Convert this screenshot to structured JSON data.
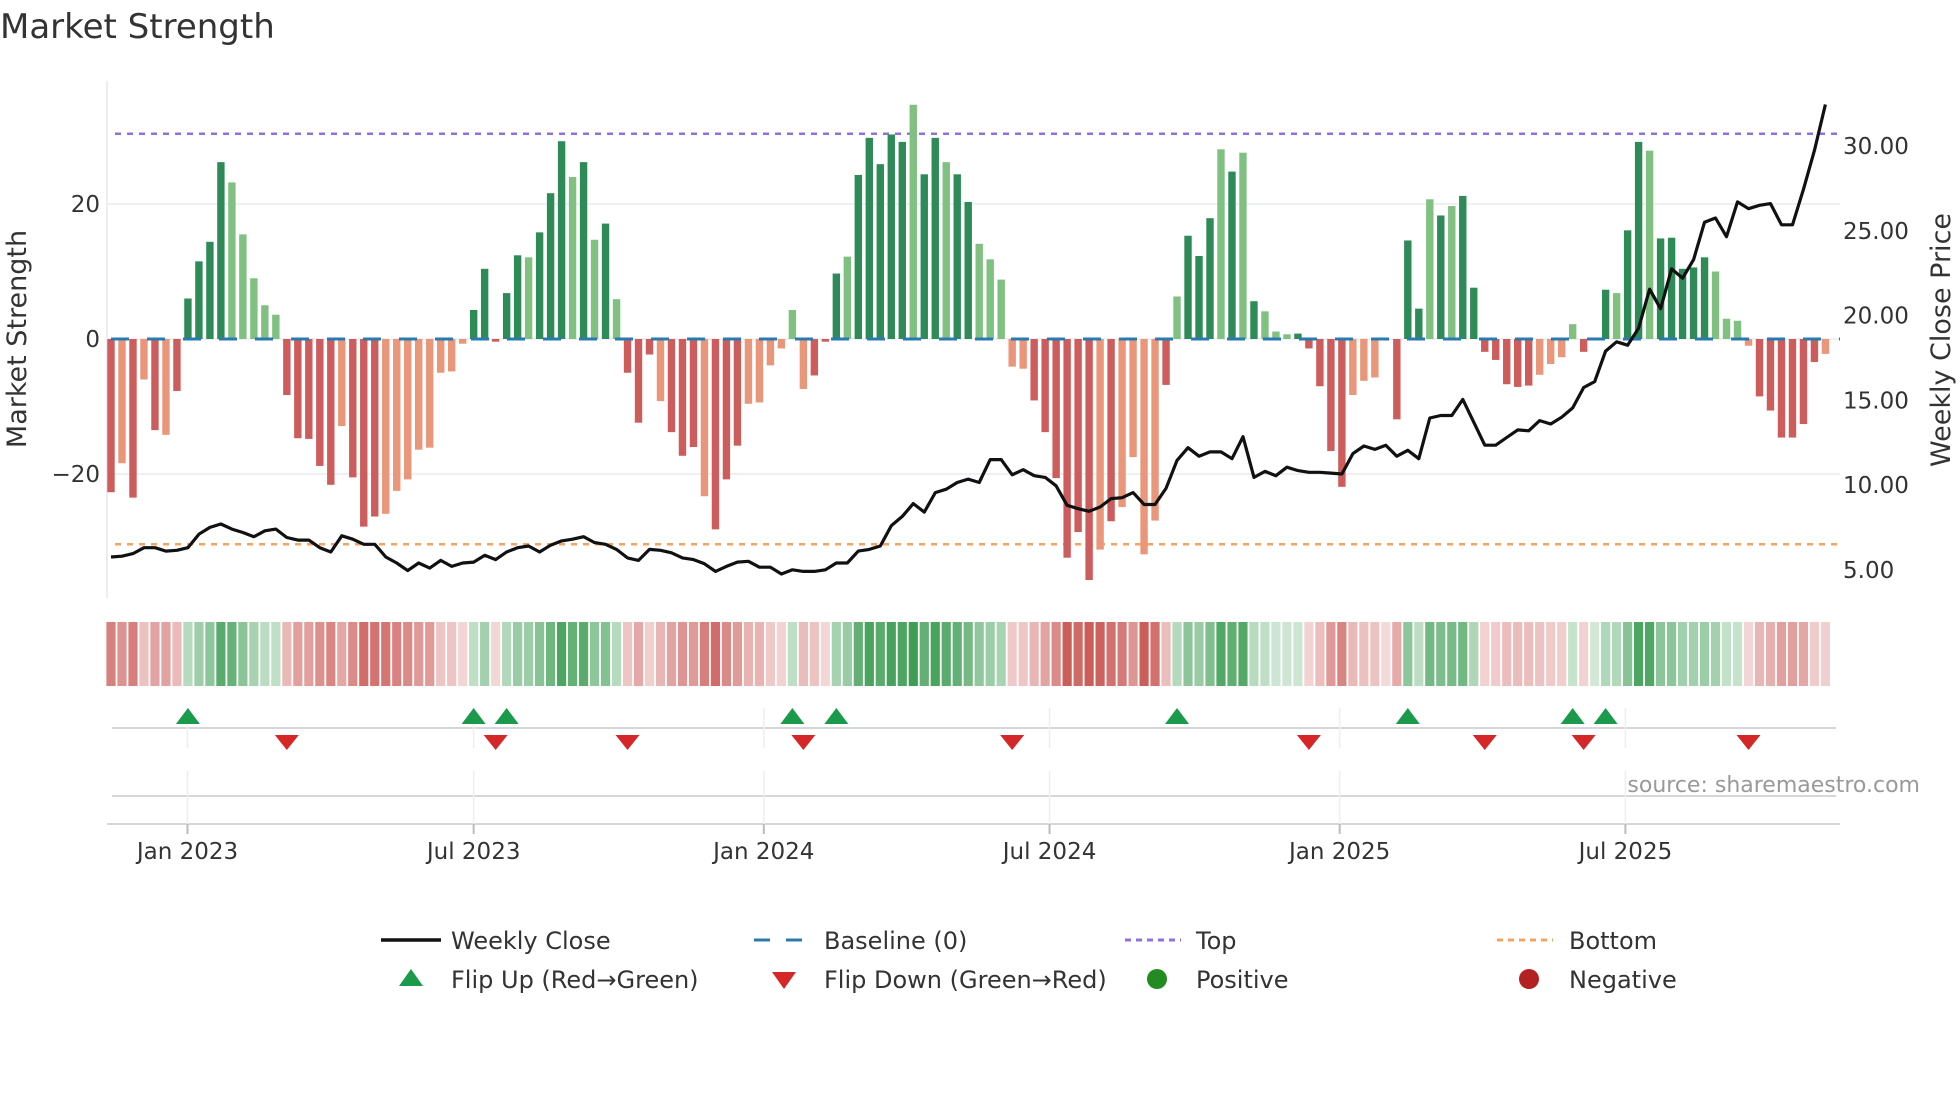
{
  "title": "Market Strength",
  "source": "source: sharemaestro.com",
  "chart_data": {
    "type": "bar",
    "title": "Market Strength",
    "ylabel": "Market Strength",
    "y2label": "Weekly Close Price",
    "ylim": [
      -38.3,
      38.1
    ],
    "y2lim": [
      3.4,
      33.8
    ],
    "yticks": [
      -20,
      0,
      20
    ],
    "ytick_labels": [
      "−20",
      "0",
      "20"
    ],
    "y2ticks": [
      5,
      10,
      15,
      20,
      25,
      30
    ],
    "y2tick_labels": [
      "5.00",
      "10.00",
      "15.00",
      "20.00",
      "25.00",
      "30.00"
    ],
    "top_level": 30.4,
    "bottom_level": -30.4,
    "x_ticks": [
      {
        "label": "Jan 2023",
        "week_index": 6.96
      },
      {
        "label": "Jul 2023",
        "week_index": 33.0
      },
      {
        "label": "Jan 2024",
        "week_index": 59.4
      },
      {
        "label": "Jul 2024",
        "week_index": 85.4
      },
      {
        "label": "Jan 2025",
        "week_index": 111.8
      },
      {
        "label": "Jul 2025",
        "week_index": 137.8
      }
    ],
    "strength": [
      -22.7,
      -18.4,
      -23.5,
      -6,
      -13.5,
      -14.2,
      -7.7,
      6,
      11.5,
      14.4,
      26.2,
      23.2,
      15.5,
      9,
      5,
      3.6,
      -8.3,
      -14.7,
      -14.8,
      -18.8,
      -21.6,
      -12.9,
      -20.5,
      -27.8,
      -26.3,
      -25.9,
      -22.5,
      -20.8,
      -16.4,
      -16.1,
      -5,
      -4.8,
      -0.7,
      4.3,
      10.4,
      -0.4,
      6.8,
      12.4,
      12.1,
      15.8,
      21.6,
      29.3,
      24,
      26.2,
      14.7,
      17.1,
      5.9,
      -5,
      -12.4,
      -2.3,
      -9.2,
      -13.8,
      -17.3,
      -16,
      -23.3,
      -28.2,
      -20.8,
      -15.8,
      -9.6,
      -9.4,
      -3.9,
      -1.4,
      4.3,
      -7.4,
      -5.4,
      -0.4,
      9.7,
      12.2,
      24.3,
      29.8,
      25.9,
      30.3,
      29.2,
      34.7,
      24.4,
      29.8,
      26.2,
      24.4,
      20.3,
      14.1,
      11.8,
      8.8,
      -4.1,
      -4.4,
      -9.1,
      -13.8,
      -20.6,
      -32.4,
      -28.6,
      -35.7,
      -31.2,
      -27,
      -24.9,
      -17.5,
      -31.9,
      -26.9,
      -6.8,
      6.3,
      15.3,
      12.3,
      17.9,
      28.1,
      24.8,
      27.6,
      5.6,
      4.1,
      1.1,
      0.7,
      0.8,
      -1.4,
      -7,
      -16.6,
      -21.9,
      -8.3,
      -6.2,
      -5.7,
      -0.1,
      -11.9,
      14.6,
      4.5,
      20.7,
      18.3,
      19.7,
      21.2,
      7.6,
      -1.9,
      -3.1,
      -6.7,
      -7.1,
      -6.9,
      -5.3,
      -3.7,
      -2.7,
      2.2,
      -1.9,
      0,
      7.3,
      6.8,
      16.1,
      29.2,
      27.9,
      14.9,
      15,
      10.4,
      10.6,
      12.1,
      10,
      3,
      2.7,
      -1,
      -8.5,
      -10.6,
      -14.6,
      -14.6,
      -12.6,
      -3.4,
      -2.2
    ],
    "shade": "dldldldddddllllldddddldddlllllllldddddldddldldldddldddldddlllllldddldddddlddlddlllllddddddldlllldldddldldllldddddlllldddldldddddddlllldddlddldddddllllddddddlll",
    "weekly_close": [
      5.75,
      5.8,
      5.95,
      6.3,
      6.3,
      6.1,
      6.15,
      6.3,
      7.1,
      7.5,
      7.7,
      7.4,
      7.2,
      6.95,
      7.3,
      7.4,
      6.9,
      6.75,
      6.75,
      6.3,
      6.05,
      7,
      6.8,
      6.5,
      6.5,
      5.75,
      5.4,
      4.95,
      5.4,
      5.1,
      5.55,
      5.2,
      5.4,
      5.45,
      5.85,
      5.6,
      6.05,
      6.3,
      6.4,
      6.05,
      6.45,
      6.7,
      6.8,
      6.95,
      6.6,
      6.5,
      6.2,
      5.7,
      5.55,
      6.2,
      6.15,
      6,
      5.7,
      5.6,
      5.35,
      4.9,
      5.2,
      5.45,
      5.5,
      5.15,
      5.15,
      4.75,
      5,
      4.9,
      4.9,
      5,
      5.4,
      5.4,
      6.1,
      6.2,
      6.4,
      7.6,
      8.15,
      8.9,
      8.4,
      9.55,
      9.75,
      10.15,
      10.35,
      10.15,
      11.5,
      11.5,
      10.6,
      10.9,
      10.55,
      10.45,
      9.95,
      8.8,
      8.6,
      8.45,
      8.7,
      9.2,
      9.25,
      9.55,
      8.85,
      8.85,
      9.8,
      11.45,
      12.2,
      11.7,
      11.95,
      11.95,
      11.55,
      12.85,
      10.45,
      10.8,
      10.55,
      11.05,
      10.85,
      10.75,
      10.75,
      10.7,
      10.65,
      11.85,
      12.3,
      12.1,
      12.35,
      11.7,
      12.05,
      11.55,
      13.95,
      14.1,
      14.1,
      15.05,
      13.7,
      12.35,
      12.35,
      12.8,
      13.25,
      13.2,
      13.8,
      13.6,
      14,
      14.55,
      15.75,
      16.1,
      17.9,
      18.45,
      18.25,
      19.25,
      21.55,
      20.4,
      22.75,
      22.2,
      23.3,
      25.5,
      25.75,
      24.65,
      26.7,
      26.3,
      26.5,
      26.6,
      25.35,
      25.35,
      27.45,
      29.75,
      32.45
    ],
    "flip_up_weeks": [
      7,
      33,
      36,
      62,
      66,
      97,
      118,
      133,
      136
    ],
    "flip_down_weeks": [
      16,
      35,
      47,
      63,
      82,
      109,
      125,
      134,
      149
    ],
    "legend": {
      "placement": "bottom",
      "items": [
        {
          "label": "Weekly Close",
          "kind": "line"
        },
        {
          "label": "Baseline (0)",
          "kind": "dash"
        },
        {
          "label": "Top",
          "kind": "dot-purple"
        },
        {
          "label": "Bottom",
          "kind": "dot-orange"
        },
        {
          "label": "Flip Up (Red→Green)",
          "kind": "tri-up"
        },
        {
          "label": "Flip Down (Green→Red)",
          "kind": "tri-down"
        },
        {
          "label": "Positive",
          "kind": "circle-green"
        },
        {
          "label": "Negative",
          "kind": "circle-red"
        }
      ]
    }
  },
  "colors": {
    "pos_dark": "#2e8b57",
    "pos_light": "#80c080",
    "neg_dark": "#cd5c5c",
    "neg_light": "#e9967a",
    "baseline": "#2a7ab0",
    "top": "#9370db",
    "bottom": "#f4a460",
    "flip_up": "#1a9a4a",
    "flip_down": "#d62728",
    "positive": "#228b22",
    "negative": "#b22222"
  }
}
